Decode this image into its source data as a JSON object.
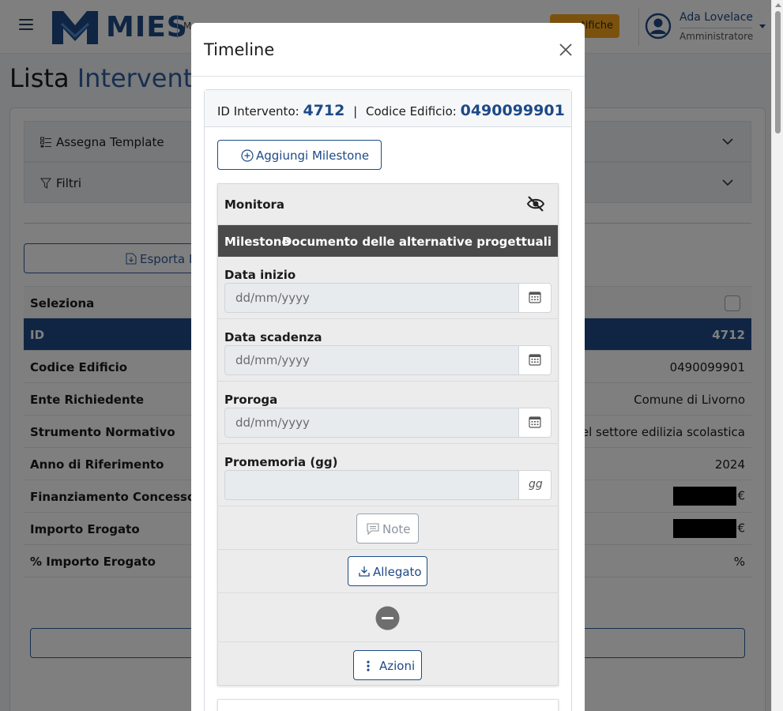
{
  "header": {
    "logo_text": "MIES",
    "logo_sub": "M",
    "notifications_label": "tifiche",
    "user": {
      "name": "Ada Lovelace",
      "role": "Amministratore"
    }
  },
  "page": {
    "title_part1": "Lista ",
    "title_part2": "Interventi",
    "accordions": [
      {
        "label": "Assegna Template"
      },
      {
        "label": "Filtri"
      }
    ],
    "export_label": "Esporta D",
    "table": {
      "rows": [
        {
          "key": "Seleziona",
          "value": ""
        },
        {
          "key": "ID",
          "value": "4712"
        },
        {
          "key": "Codice Edificio",
          "value": "0490099901"
        },
        {
          "key": "Ente Richiedente",
          "value": "Comune di Livorno"
        },
        {
          "key": "Strumento Normativo",
          "value": "li nel settore edilizia scolastica"
        },
        {
          "key": "Anno di Riferimento",
          "value": "2024"
        },
        {
          "key": "Finanziamento Concesso",
          "value": "€"
        },
        {
          "key": "Importo Erogato",
          "value": "€"
        },
        {
          "key": "% Importo Erogato",
          "value": "%"
        }
      ]
    }
  },
  "modal": {
    "title": "Timeline",
    "id_label": "ID Intervento:",
    "id_value": "4712",
    "separator": "|",
    "code_label": "Codice Edificio:",
    "code_value": "0490099901",
    "add_milestone_label": "Aggiungi Milestone",
    "milestone": {
      "monitor_label": "Monitora",
      "milestone_key": "Milestone",
      "milestone_value": "Documento delle alternative progettuali",
      "fields": {
        "start": {
          "label": "Data inizio",
          "placeholder": "dd/mm/yyyy"
        },
        "deadline": {
          "label": "Data scadenza",
          "placeholder": "dd/mm/yyyy"
        },
        "extension": {
          "label": "Proroga",
          "placeholder": "dd/mm/yyyy"
        },
        "reminder": {
          "label": "Promemoria (gg)",
          "placeholder": "",
          "addon": "gg"
        }
      },
      "note_label": "Note",
      "attachment_label": "Allegato",
      "actions_label": "Azioni"
    }
  },
  "colors": {
    "primary": "#1e4a86",
    "accent": "#f4a51c",
    "milestone_header": "#4a4a4a"
  }
}
